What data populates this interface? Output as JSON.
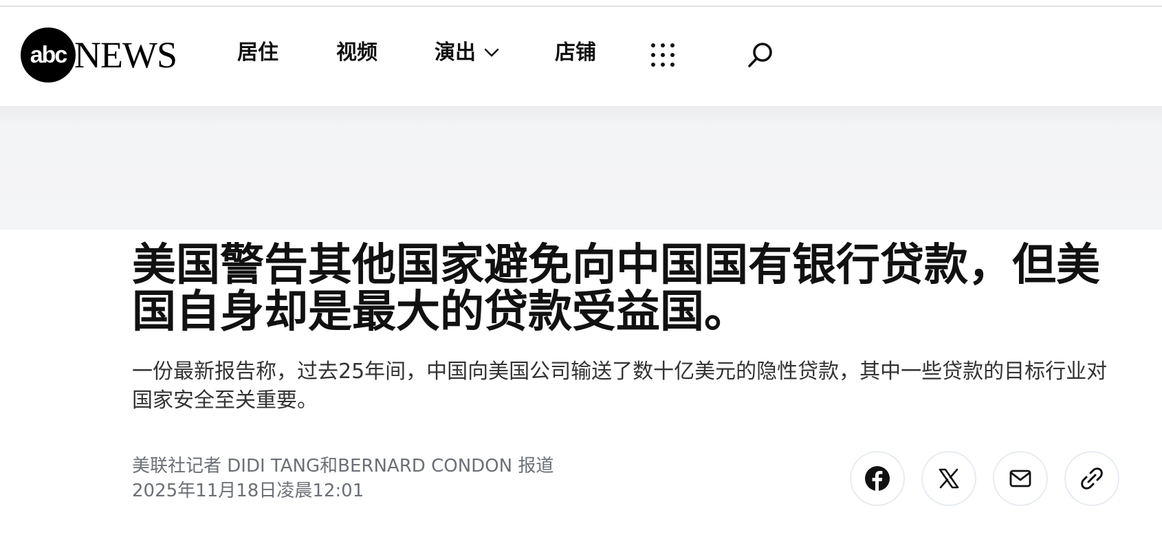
{
  "brand": {
    "logo_mark": "abc",
    "logo_text": "NEWS"
  },
  "nav": {
    "items": [
      {
        "label": "居住"
      },
      {
        "label": "视频"
      },
      {
        "label": "演出",
        "has_dropdown": true
      },
      {
        "label": "店铺"
      }
    ],
    "more_icon": "grid-dots-icon",
    "search_icon": "search-icon"
  },
  "article": {
    "headline": "美国警告其他国家避免向中国国有银行贷款，但美国自身却是最大的贷款受益国。",
    "subhead": "一份最新报告称，过去25年间，中国向美国公司输送了数十亿美元的隐性贷款，其中一些贷款的目标行业对国家安全至关重要。",
    "byline": "美联社记者 DIDI TANG和BERNARD CONDON 报道",
    "date": "2025年11月18日凌晨12:01"
  },
  "share": {
    "icons": [
      "facebook-icon",
      "x-icon",
      "email-icon",
      "link-icon"
    ]
  },
  "colors": {
    "ad_band": "#f4f5f7",
    "byline_gray": "#6b6f77",
    "share_border": "#e6ebf2"
  }
}
